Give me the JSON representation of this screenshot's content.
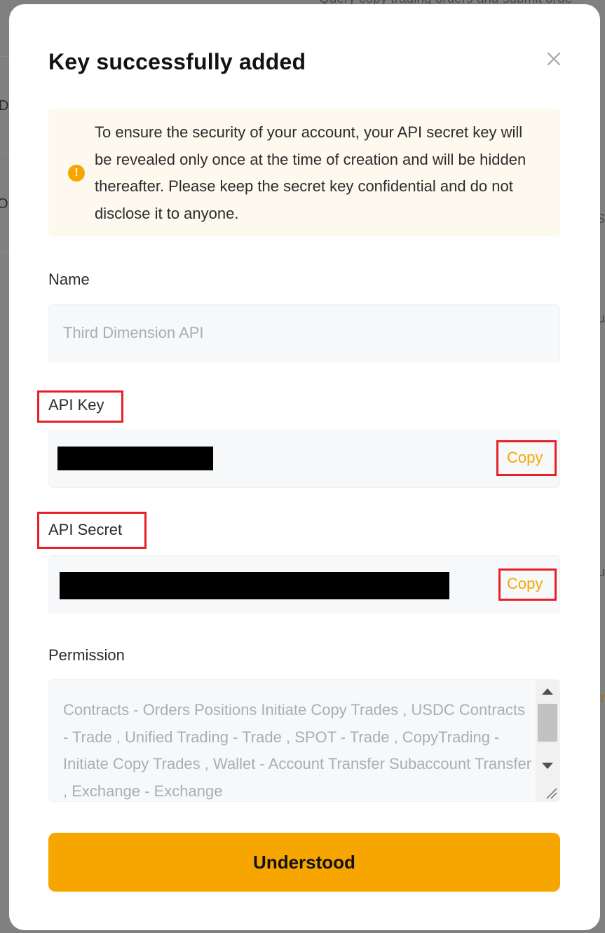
{
  "background": {
    "top_snippet": "Query copy trading orders and submit orde",
    "left_letters": [
      "D",
      "O"
    ],
    "right_letters": [
      "S",
      "u",
      "u",
      "r"
    ]
  },
  "modal": {
    "title": "Key successfully added",
    "close_icon": "close-icon",
    "notice": {
      "icon": "warning-icon",
      "text": "To ensure the security of your account, your API secret key will be revealed only once at the time of creation and will be hidden thereafter. Please keep the secret key confidential and do not disclose it to anyone."
    },
    "name": {
      "label": "Name",
      "value": "Third Dimension API"
    },
    "api_key": {
      "label": "API Key",
      "copy_label": "Copy"
    },
    "api_secret": {
      "label": "API Secret",
      "copy_label": "Copy"
    },
    "permission": {
      "label": "Permission",
      "value": "Contracts - Orders Positions Initiate Copy Trades  , USDC Contracts - Trade  , Unified Trading - Trade  , SPOT - Trade  , CopyTrading - Initiate Copy Trades  , Wallet - Account Transfer Subaccount Transfer  , Exchange - Exchange"
    },
    "confirm_label": "Understood"
  },
  "colors": {
    "accent": "#f7a600",
    "highlight": "#e8202a",
    "notice_bg": "#fef9ee"
  }
}
